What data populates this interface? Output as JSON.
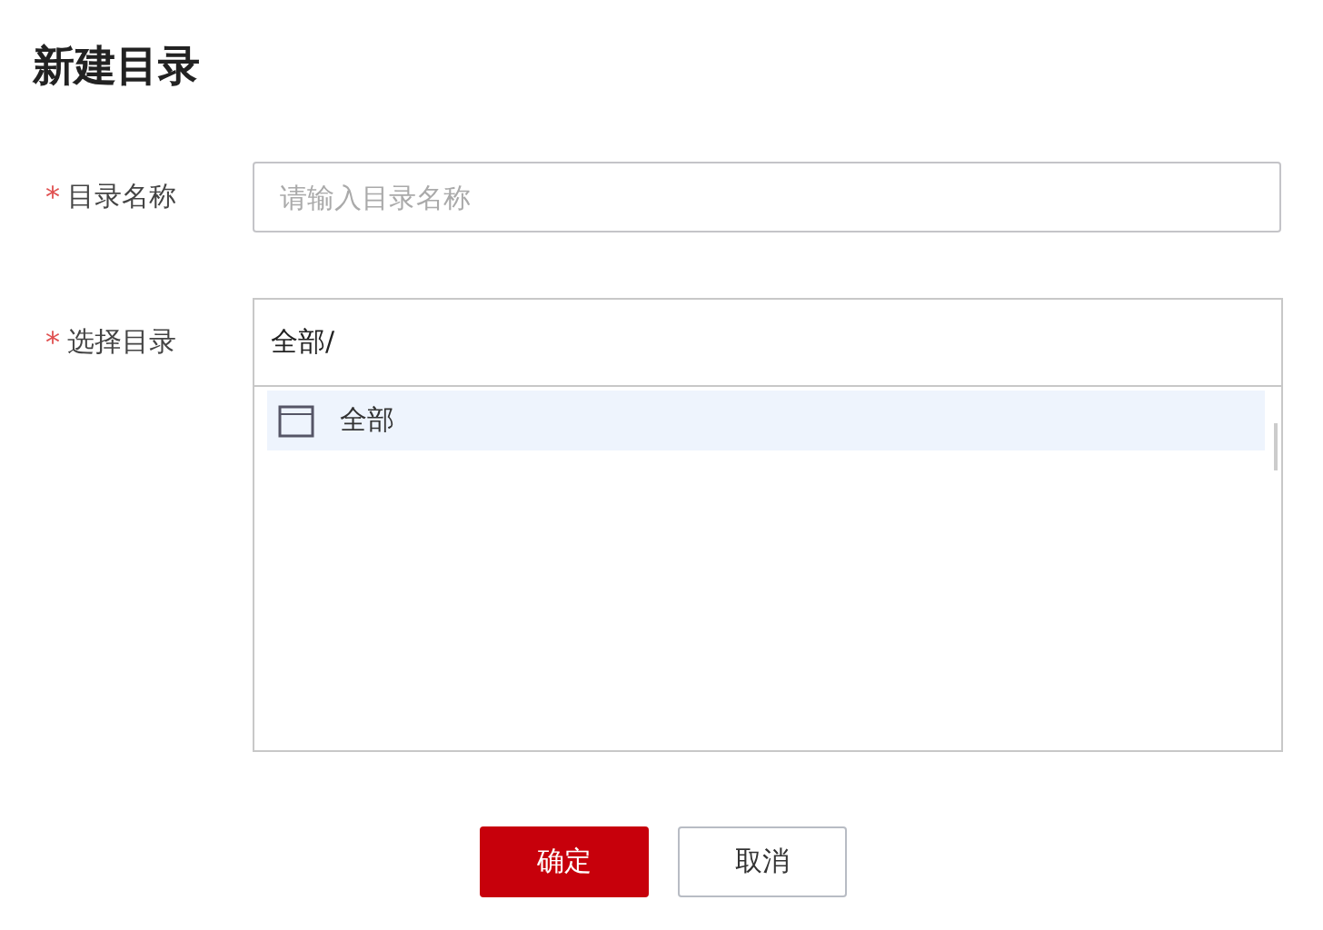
{
  "title": "新建目录",
  "name_field": {
    "required_mark": "*",
    "label": "目录名称",
    "placeholder": "请输入目录名称"
  },
  "directory_field": {
    "required_mark": "*",
    "label": "选择目录",
    "path": "全部/",
    "tree": [
      {
        "label": "全部",
        "selected": true
      }
    ]
  },
  "buttons": [
    {
      "label": "确定",
      "kind": "primary"
    },
    {
      "label": "取消",
      "kind": "default"
    }
  ]
}
